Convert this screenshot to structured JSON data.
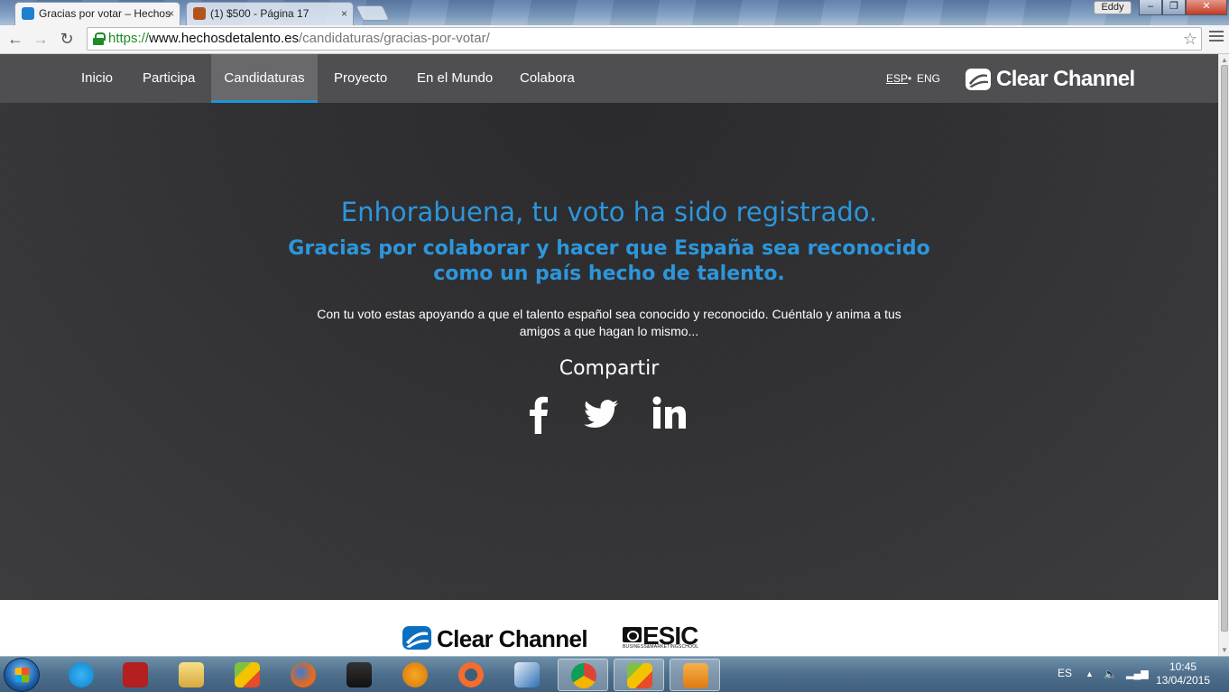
{
  "browser": {
    "tabs": [
      {
        "title": "Gracias por votar – Hechos",
        "favicon_color": "#1f7fd0",
        "active": true
      },
      {
        "title": "(1) $500 - Página 17",
        "favicon_color": "#b3531c",
        "active": false
      }
    ],
    "close_glyph": "×",
    "user_name": "Eddy",
    "window_buttons": {
      "minimize": "‒",
      "maximize": "❐",
      "close": "✕"
    },
    "nav": {
      "back": "←",
      "forward": "→",
      "reload": "↻"
    },
    "url": {
      "scheme": "https://",
      "host": "www.hechosdetalento.es",
      "path": "/candidaturas/gracias-por-votar/"
    },
    "bookmark_star": "☆"
  },
  "site": {
    "nav_items": [
      "Inicio",
      "Participa",
      "Candidaturas",
      "Proyecto",
      "En el Mundo",
      "Colabora"
    ],
    "active_nav": "Candidaturas",
    "languages": {
      "esp": "ESP",
      "separator": "•",
      "eng": "ENG"
    },
    "brand": "Clear Channel",
    "brand_colors": {
      "header_logo": "#ffffff",
      "footer_logo": "#0a0a0a",
      "mark_blue": "#0b6fc1"
    },
    "accent_color": "#2c96dc"
  },
  "hero": {
    "title": "Enhorabuena, tu voto ha sido registrado.",
    "subtitle": "Gracias por colaborar y hacer que España sea reconocido como un país hecho de talento.",
    "body": "Con tu voto estas apoyando a que el talento español sea conocido y reconocido. Cuéntalo y anima a tus amigos a que hagan lo mismo...",
    "share_label": "Compartir",
    "social": [
      "facebook-icon",
      "twitter-icon",
      "linkedin-icon"
    ]
  },
  "footer": {
    "partner_brand": "Clear Channel",
    "esic": {
      "name": "ESIC",
      "tagline": "BUSINESS&MARKETINGSCHOOL"
    }
  },
  "taskbar": {
    "apps": [
      "skype-icon",
      "ccleaner-icon",
      "file-explorer-icon",
      "bluestacks-icon",
      "firefox-icon",
      "media-player-icon",
      "fl-studio-icon",
      "origin-icon",
      "editor-icon",
      "chrome-icon",
      "bluestacks-running-icon",
      "video-player-icon"
    ],
    "language": "ES",
    "time": "10:45",
    "date": "13/04/2015"
  }
}
